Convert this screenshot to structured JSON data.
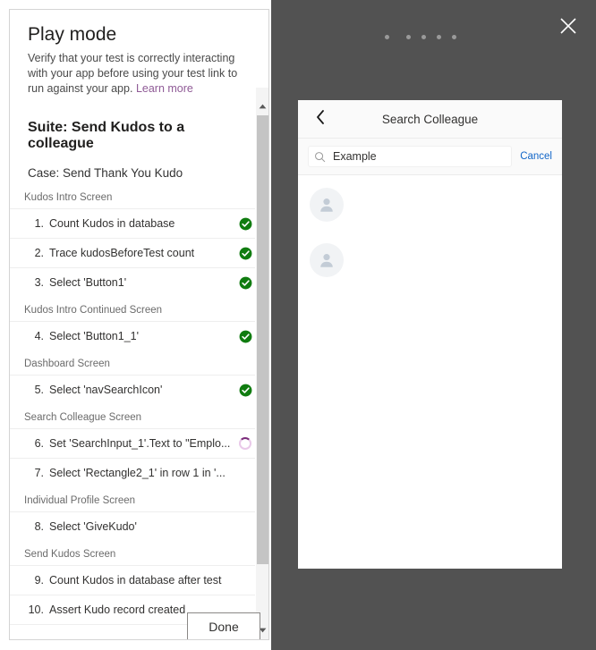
{
  "panel": {
    "title": "Play mode",
    "description": "Verify that your test is correctly interacting with your app before using your test link to run against your app.",
    "learn_more_label": "Learn more",
    "suite_label": "Suite: Send Kudos to a colleague",
    "case_label": "Case: Send Thank You Kudo",
    "done_label": "Done",
    "accent_link_color": "#8f5a96"
  },
  "groups": [
    {
      "label": "Kudos Intro Screen",
      "steps": [
        {
          "num": "1.",
          "text": "Count Kudos in database",
          "status": "passed"
        },
        {
          "num": "2.",
          "text": "Trace kudosBeforeTest count",
          "status": "passed"
        },
        {
          "num": "3.",
          "text": "Select 'Button1'",
          "status": "passed"
        }
      ]
    },
    {
      "label": "Kudos Intro Continued Screen",
      "steps": [
        {
          "num": "4.",
          "text": "Select 'Button1_1'",
          "status": "passed"
        }
      ]
    },
    {
      "label": "Dashboard Screen",
      "steps": [
        {
          "num": "5.",
          "text": "Select 'navSearchIcon'",
          "status": "passed"
        }
      ]
    },
    {
      "label": "Search Colleague Screen",
      "steps": [
        {
          "num": "6.",
          "text": "Set 'SearchInput_1'.Text to \"Emplo...",
          "status": "running"
        },
        {
          "num": "7.",
          "text": "Select 'Rectangle2_1' in row 1 in '...",
          "status": "none"
        }
      ]
    },
    {
      "label": "Individual Profile Screen",
      "steps": [
        {
          "num": "8.",
          "text": "Select 'GiveKudo'",
          "status": "none"
        }
      ]
    },
    {
      "label": "Send Kudos Screen",
      "steps": [
        {
          "num": "9.",
          "text": "Count Kudos in database after test",
          "status": "none"
        },
        {
          "num": "10.",
          "text": "Assert Kudo record created",
          "status": "none"
        }
      ]
    }
  ],
  "overlay": {
    "close_icon": "close-icon",
    "loading_dots": 5,
    "background_color": "#525252"
  },
  "app_preview": {
    "back_icon": "back-chevron-icon",
    "title": "Search Colleague",
    "search": {
      "icon": "search-icon",
      "value": "Example",
      "placeholder": "Example"
    },
    "cancel_label": "Cancel",
    "cancel_color": "#1266c8",
    "results": [
      {
        "avatar": "person-avatar-icon"
      },
      {
        "avatar": "person-avatar-icon"
      }
    ]
  }
}
